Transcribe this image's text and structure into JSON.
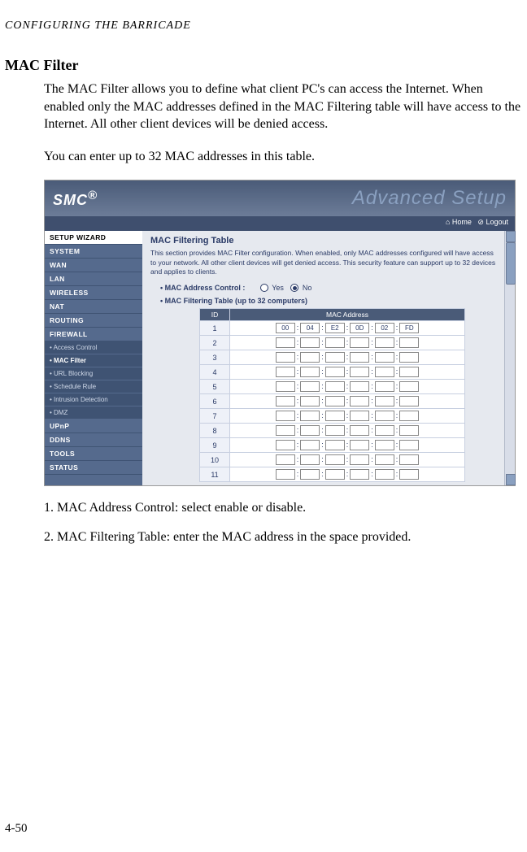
{
  "doc": {
    "running_head": "CONFIGURING THE BARRICADE",
    "heading": "MAC Filter",
    "para1": "The MAC Filter allows you to define what client PC's can access the Internet. When enabled only the MAC addresses defined in the MAC Filtering table will have access to the Internet. All other client devices will be denied access.",
    "para2": "You can enter up to 32 MAC addresses in this table.",
    "step1": "1.   MAC Address Control: select enable or disable.",
    "step2": "2.   MAC Filtering Table: enter the MAC address in the space provided.",
    "page_num": "4-50"
  },
  "ui": {
    "logo": "SMC",
    "logo_sup": "®",
    "adv": "Advanced Setup",
    "nav_home": "Home",
    "nav_logout": "Logout",
    "sidebar": {
      "wizard": "SETUP WIZARD",
      "items": [
        "SYSTEM",
        "WAN",
        "LAN",
        "WIRELESS",
        "NAT",
        "ROUTING",
        "FIREWALL"
      ],
      "subs": [
        "Access Control",
        "MAC Filter",
        "URL Blocking",
        "Schedule Rule",
        "Intrusion Detection",
        "DMZ"
      ],
      "tail": [
        "UPnP",
        "DDNS",
        "TOOLS",
        "STATUS"
      ]
    },
    "content": {
      "title": "MAC Filtering Table",
      "desc": "This section provides MAC Filter configuration. When enabled, only MAC addresses configured will have access to your network. All other client devices will get denied access. This security feature can support up to 32 devices and applies to clients.",
      "mac_ctrl_label": "MAC Address Control :",
      "yes": "Yes",
      "no": "No",
      "table_label": "MAC Filtering Table (up to 32 computers)",
      "th_id": "ID",
      "th_mac": "MAC Address",
      "rows": [
        {
          "id": "1",
          "oct": [
            "00",
            "04",
            "E2",
            "0D",
            "02",
            "FD"
          ]
        },
        {
          "id": "2",
          "oct": [
            "",
            "",
            "",
            "",
            "",
            ""
          ]
        },
        {
          "id": "3",
          "oct": [
            "",
            "",
            "",
            "",
            "",
            ""
          ]
        },
        {
          "id": "4",
          "oct": [
            "",
            "",
            "",
            "",
            "",
            ""
          ]
        },
        {
          "id": "5",
          "oct": [
            "",
            "",
            "",
            "",
            "",
            ""
          ]
        },
        {
          "id": "6",
          "oct": [
            "",
            "",
            "",
            "",
            "",
            ""
          ]
        },
        {
          "id": "7",
          "oct": [
            "",
            "",
            "",
            "",
            "",
            ""
          ]
        },
        {
          "id": "8",
          "oct": [
            "",
            "",
            "",
            "",
            "",
            ""
          ]
        },
        {
          "id": "9",
          "oct": [
            "",
            "",
            "",
            "",
            "",
            ""
          ]
        },
        {
          "id": "10",
          "oct": [
            "",
            "",
            "",
            "",
            "",
            ""
          ]
        },
        {
          "id": "11",
          "oct": [
            "",
            "",
            "",
            "",
            "",
            ""
          ]
        }
      ]
    }
  }
}
